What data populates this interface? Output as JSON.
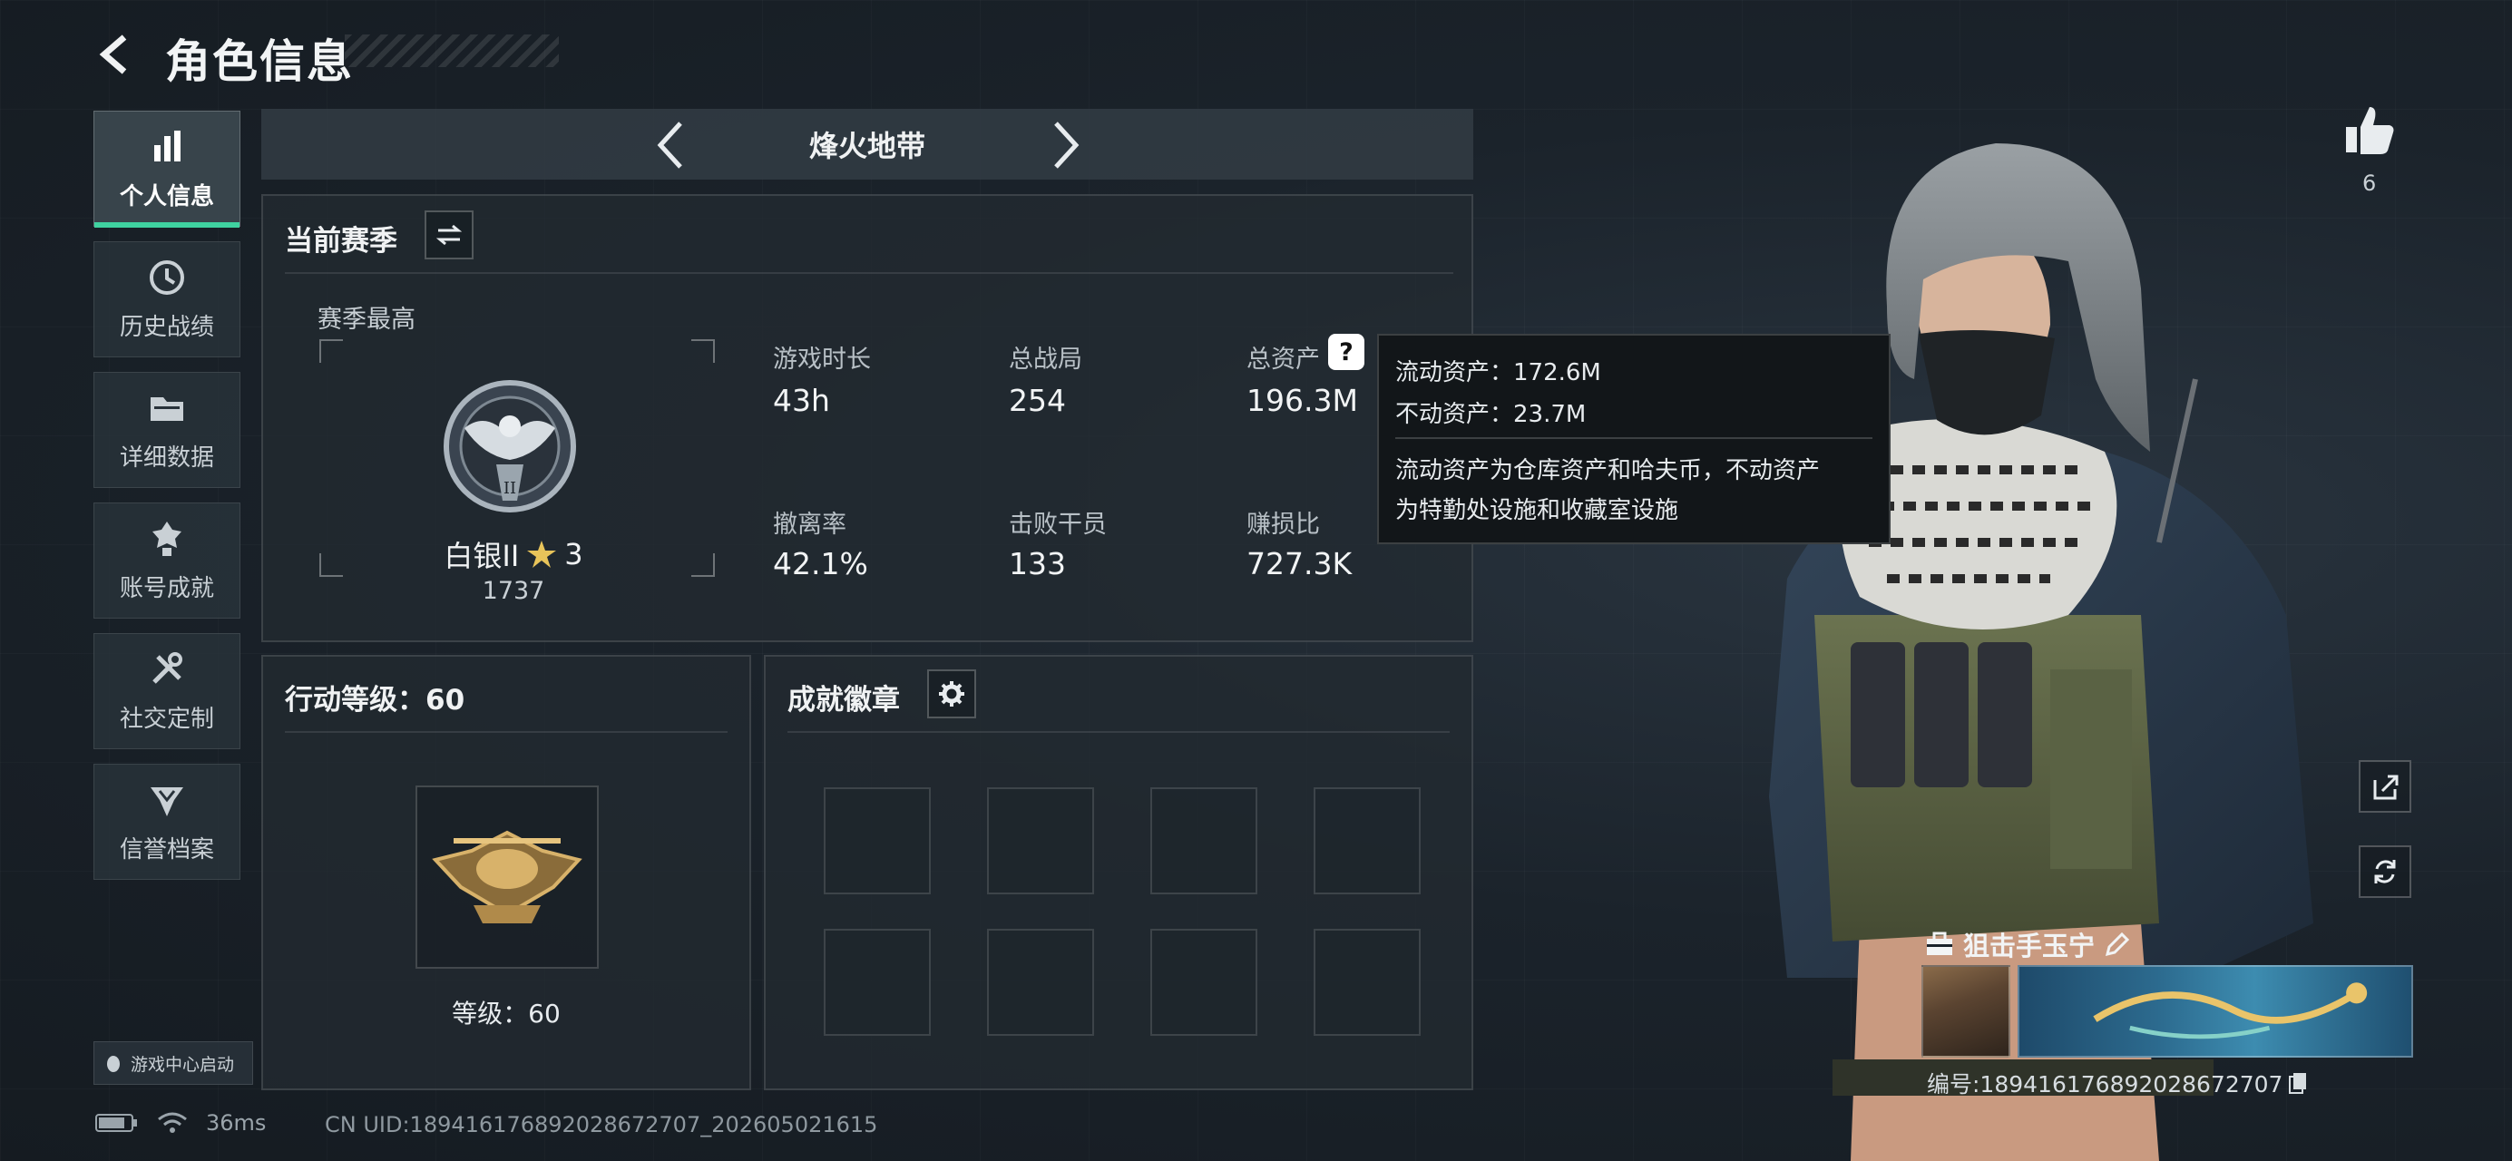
{
  "header": {
    "title": "角色信息"
  },
  "sidebar": {
    "items": [
      {
        "label": "个人信息",
        "icon": "bar-chart-icon",
        "active": true
      },
      {
        "label": "历史战绩",
        "icon": "history-clock-icon",
        "active": false
      },
      {
        "label": "详细数据",
        "icon": "folder-icon",
        "active": false
      },
      {
        "label": "账号成就",
        "icon": "achievement-medal-icon",
        "active": false
      },
      {
        "label": "社交定制",
        "icon": "tools-icon",
        "active": false
      },
      {
        "label": "信誉档案",
        "icon": "credit-shield-icon",
        "active": false
      }
    ],
    "launcher_label": "游戏中心启动"
  },
  "mode": {
    "label": "烽火地带"
  },
  "season_panel": {
    "title": "当前赛季",
    "rank_section_label": "赛季最高",
    "rank_name": "白银II",
    "rank_stars": "3",
    "rank_score": "1737",
    "stats": [
      {
        "label": "游戏时长",
        "value": "43h"
      },
      {
        "label": "总战局",
        "value": "254"
      },
      {
        "label": "总资产",
        "value": "196.3M"
      },
      {
        "label": "撤离率",
        "value": "42.1%"
      },
      {
        "label": "击败干员",
        "value": "133"
      },
      {
        "label": "赚损比",
        "value": "727.3K"
      }
    ]
  },
  "tooltip": {
    "liquid": "流动资产：172.6M",
    "fixed": "不动资产：23.7M",
    "note_line1": "流动资产为仓库资产和哈夫币，不动资产",
    "note_line2": "为特勤处设施和收藏室设施"
  },
  "action_level_panel": {
    "title": "行动等级：60",
    "level_label": "等级：60"
  },
  "badge_panel": {
    "title": "成就徽章",
    "slots": 8
  },
  "profile": {
    "likes": "6",
    "player_name": "狙击手玉宁",
    "player_id": "编号:18941617689202867270​7"
  },
  "status_bar": {
    "ping": "36ms",
    "uid": "CN UID:18941617689202867270​7_202605021615"
  },
  "colors": {
    "accent": "#3fd2a0",
    "panel_bg": "#222a31",
    "tooltip_bg": "#121619"
  }
}
